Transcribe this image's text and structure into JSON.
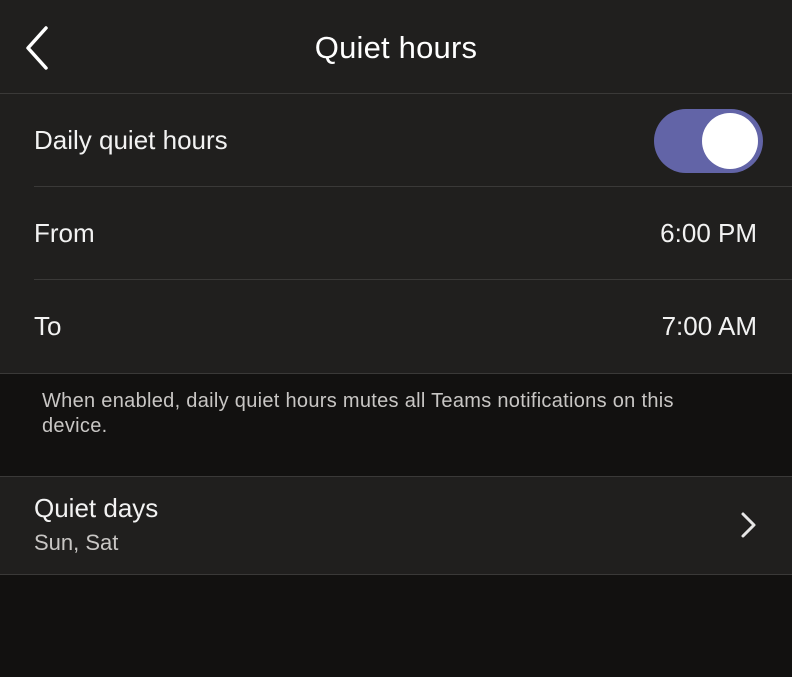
{
  "header": {
    "title": "Quiet hours",
    "back_icon": "chevron-left-icon"
  },
  "daily_quiet_hours": {
    "label": "Daily quiet hours",
    "enabled": true,
    "toggle_color": "#6264a7"
  },
  "from": {
    "label": "From",
    "value": "6:00 PM"
  },
  "to": {
    "label": "To",
    "value": "7:00 AM"
  },
  "footnote": "When enabled, daily quiet hours mutes all Teams notifications on this device.",
  "quiet_days": {
    "title": "Quiet days",
    "value": "Sun, Sat",
    "chevron_icon": "chevron-right-icon"
  }
}
